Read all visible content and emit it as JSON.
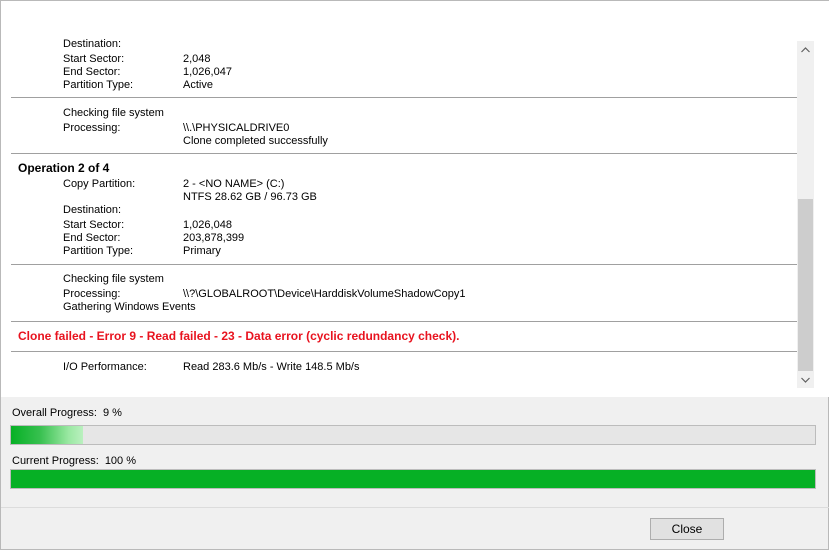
{
  "log": {
    "op1": {
      "destination_label": "Destination:",
      "start_sector_label": "Start Sector:",
      "start_sector_value": "2,048",
      "end_sector_label": "End Sector:",
      "end_sector_value": "1,026,047",
      "partition_type_label": "Partition Type:",
      "partition_type_value": "Active",
      "check_fs": "Checking file system",
      "processing_label": "Processing:",
      "processing_value": "\\\\.\\PHYSICALDRIVE0",
      "result": "Clone completed successfully"
    },
    "op2": {
      "title": "Operation 2 of 4",
      "copy_partition_label": "Copy Partition:",
      "copy_partition_value": "2 - <NO NAME> (C:)",
      "copy_partition_detail": "NTFS 28.62 GB / 96.73 GB",
      "destination_label": "Destination:",
      "start_sector_label": "Start Sector:",
      "start_sector_value": "1,026,048",
      "end_sector_label": "End Sector:",
      "end_sector_value": "203,878,399",
      "partition_type_label": "Partition Type:",
      "partition_type_value": "Primary",
      "check_fs": "Checking file system",
      "processing_label": "Processing:",
      "processing_value": "\\\\?\\GLOBALROOT\\Device\\HarddiskVolumeShadowCopy1",
      "events": "Gathering Windows Events"
    },
    "error": "Clone failed - Error 9 - Read failed - 23 - Data error (cyclic redundancy check).",
    "io_label": "I/O Performance:",
    "io_value": "Read 283.6 Mb/s - Write 148.5 Mb/s"
  },
  "progress": {
    "overall_label": "Overall Progress:",
    "overall_value": "9 %",
    "overall_fraction": 0.09,
    "current_label": "Current Progress:",
    "current_value": "100 %",
    "current_fraction": 1.0
  },
  "buttons": {
    "close_label": "Close"
  },
  "icons": {
    "scroll_up": "chevron-up-icon",
    "scroll_down": "chevron-down-icon"
  },
  "colors": {
    "progress_green": "#06b025",
    "error_red": "#e8131f"
  }
}
